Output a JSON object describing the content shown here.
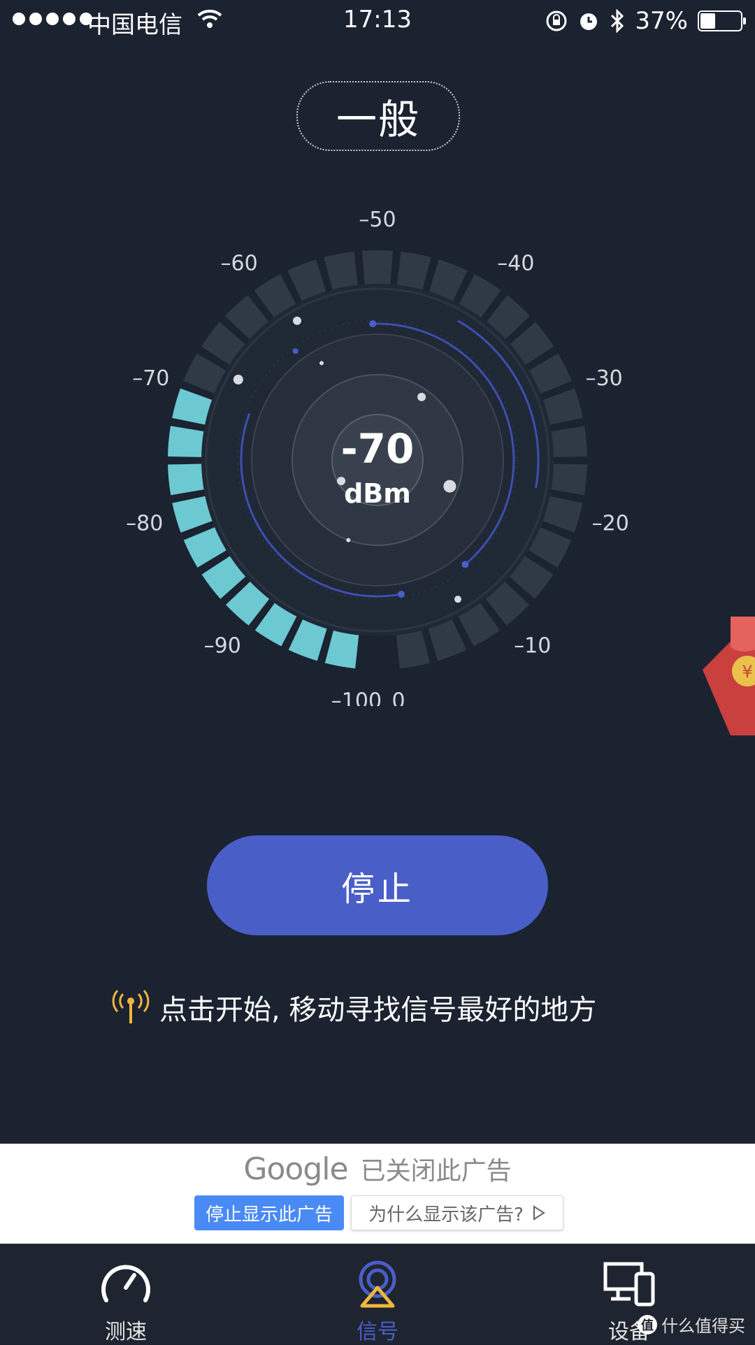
{
  "status_bar": {
    "carrier": "中国电信",
    "time": "17:13",
    "battery": "37%",
    "battery_level": 0.37
  },
  "quality_label": "一般",
  "gauge": {
    "reading": "-70",
    "unit": "dBm",
    "value": -70,
    "min": -100,
    "max": 0,
    "ticks": [
      "–100",
      "–90",
      "–80",
      "–70",
      "–60",
      "–50",
      "–40",
      "–30",
      "–20",
      "–10",
      "0"
    ],
    "colors": {
      "active": "#6cc9d2",
      "inactive": "#2f3a45",
      "ring": "#3d4fb0"
    }
  },
  "stop_button": "停止",
  "hint_text": "点击开始, 移动寻找信号最好的地方",
  "ad": {
    "brand": "Google",
    "closed_text": "已关闭此广告",
    "stop_label": "停止显示此广告",
    "why_label": "为什么显示该广告?"
  },
  "tabs": [
    {
      "label": "测速",
      "icon": "speedometer-icon"
    },
    {
      "label": "信号",
      "icon": "signal-icon"
    },
    {
      "label": "设备",
      "icon": "devices-icon"
    }
  ],
  "watermark": {
    "text": "什么值得买",
    "badge": "值"
  }
}
